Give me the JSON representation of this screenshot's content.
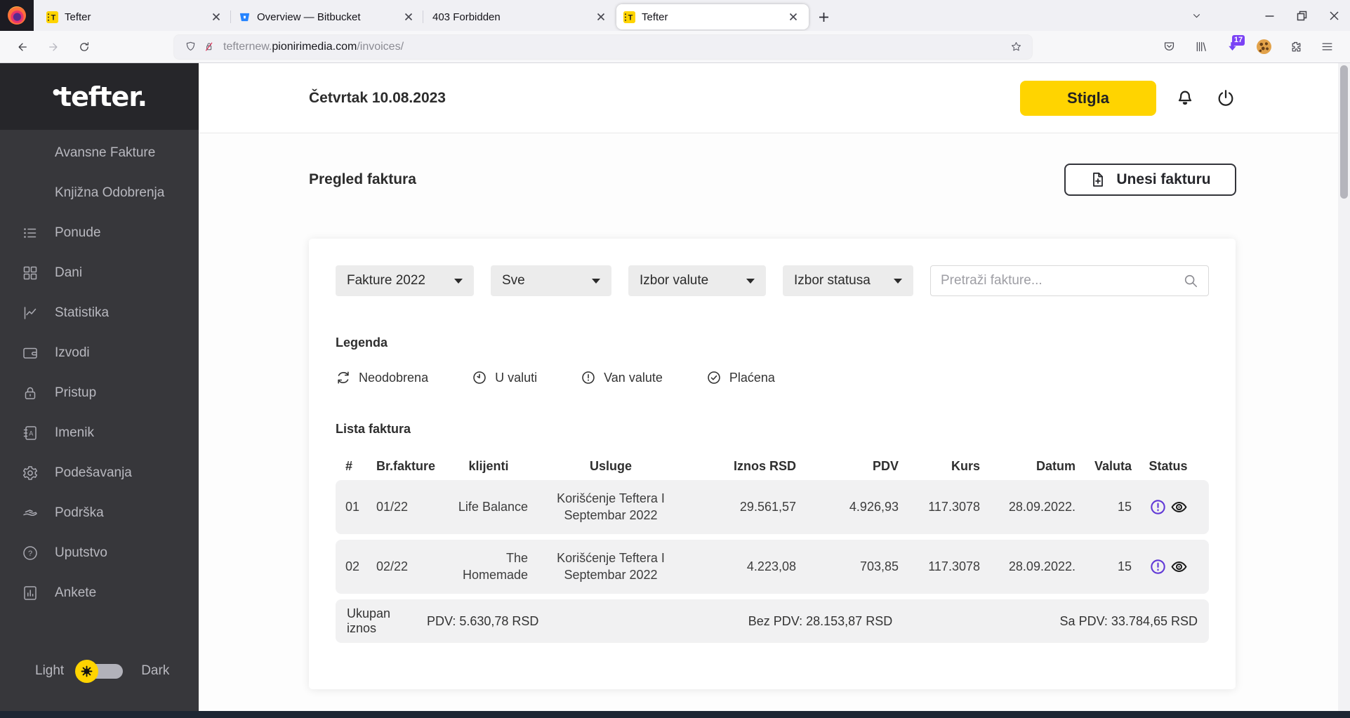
{
  "browser": {
    "tabs": [
      {
        "title": "Tefter"
      },
      {
        "title": "Overview — Bitbucket"
      },
      {
        "title": "403 Forbidden"
      },
      {
        "title": "Tefter"
      }
    ],
    "url": {
      "prefix": "tefternew.",
      "domain": "pionirimedia.com",
      "path": "/invoices/"
    },
    "download_badge": "17"
  },
  "sidebar": {
    "logo": {
      "dot": "•",
      "text": "tefter."
    },
    "items": [
      {
        "label": "Avansne Fakture"
      },
      {
        "label": "Knjižna Odobrenja"
      },
      {
        "label": "Ponude"
      },
      {
        "label": "Dani"
      },
      {
        "label": "Statistika"
      },
      {
        "label": "Izvodi"
      },
      {
        "label": "Pristup"
      },
      {
        "label": "Imenik"
      },
      {
        "label": "Podešavanja"
      },
      {
        "label": "Podrška"
      },
      {
        "label": "Uputstvo"
      },
      {
        "label": "Ankete"
      }
    ],
    "theme_toggle": {
      "light": "Light",
      "dark": "Dark",
      "value": "light"
    }
  },
  "header": {
    "date": "Četvrtak 10.08.2023",
    "status_button": "Stigla"
  },
  "main": {
    "title": "Pregled faktura",
    "add_button": "Unesi fakturu",
    "filters": {
      "year": "Fakture 2022",
      "client": "Sve",
      "currency": "Izbor valute",
      "status": "Izbor statusa",
      "search_placeholder": "Pretraži fakture..."
    },
    "legend": {
      "title": "Legenda",
      "items": [
        {
          "label": "Neodobrena",
          "icon": "refresh-icon"
        },
        {
          "label": "U valuti",
          "icon": "clock-icon"
        },
        {
          "label": "Van valute",
          "icon": "exclamation-icon"
        },
        {
          "label": "Plaćena",
          "icon": "check-icon"
        }
      ]
    },
    "table": {
      "title": "Lista faktura",
      "columns": [
        "#",
        "Br.fakture",
        "klijenti",
        "Usluge",
        "Iznos RSD",
        "PDV",
        "Kurs",
        "Datum",
        "Valuta",
        "Status"
      ],
      "rows": [
        {
          "num": "01",
          "br": "01/22",
          "klijent": "Life Balance",
          "usluga_line1": "Korišćenje Teftera I",
          "usluga_line2": "Septembar 2022",
          "iznos": "29.561,57",
          "pdv": "4.926,93",
          "kurs": "117.3078",
          "datum": "28.09.2022.",
          "valuta": "15",
          "status_icons": [
            "exclamation-icon",
            "eye-icon"
          ]
        },
        {
          "num": "02",
          "br": "02/22",
          "klijent": "The Homemade",
          "usluga_line1": "Korišćenje Teftera I",
          "usluga_line2": "Septembar 2022",
          "iznos": "4.223,08",
          "pdv": "703,85",
          "kurs": "117.3078",
          "datum": "28.09.2022.",
          "valuta": "15",
          "status_icons": [
            "exclamation-icon",
            "eye-icon"
          ]
        }
      ],
      "totals": {
        "label": "Ukupan iznos",
        "pdv": "PDV: 5.630,78 RSD",
        "bez_pdv": "Bez PDV: 28.153,87 RSD",
        "sa_pdv": "Sa PDV: 33.784,65 RSD"
      }
    }
  },
  "colors": {
    "accent_yellow": "#ffd400",
    "status_purple": "#6139d6",
    "sidebar_bg": "#37373b",
    "sidebar_logo_bg": "#26262a",
    "row_bg": "#f1f1f2"
  }
}
